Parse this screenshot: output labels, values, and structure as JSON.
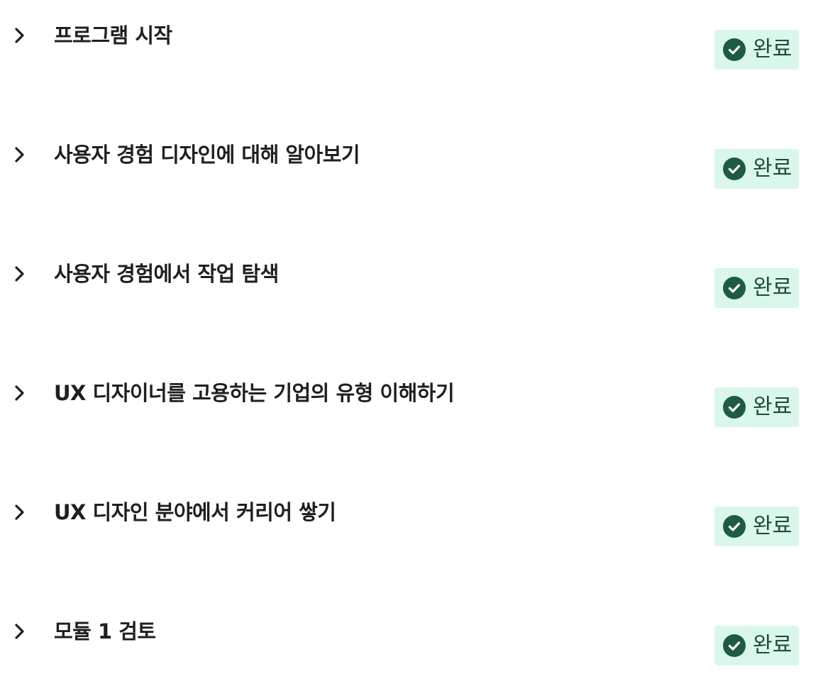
{
  "modules": [
    {
      "title": "프로그램 시작",
      "status": "완료",
      "status_icon": "check-circle-icon",
      "expand_icon": "chevron-right-icon"
    },
    {
      "title": "사용자 경험 디자인에 대해 알아보기",
      "status": "완료",
      "status_icon": "check-circle-icon",
      "expand_icon": "chevron-right-icon"
    },
    {
      "title": "사용자 경험에서 작업 탐색",
      "status": "완료",
      "status_icon": "check-circle-icon",
      "expand_icon": "chevron-right-icon"
    },
    {
      "title": "UX 디자이너를 고용하는 기업의 유형 이해하기",
      "status": "완료",
      "status_icon": "check-circle-icon",
      "expand_icon": "chevron-right-icon"
    },
    {
      "title": "UX 디자인 분야에서 커리어 쌓기",
      "status": "완료",
      "status_icon": "check-circle-icon",
      "expand_icon": "chevron-right-icon"
    },
    {
      "title": "모듈 1 검토",
      "status": "완료",
      "status_icon": "check-circle-icon",
      "expand_icon": "chevron-right-icon"
    }
  ],
  "colors": {
    "badge_background": "#d9f7ea",
    "badge_text": "#1e4d3a",
    "check_icon": "#1e5b43",
    "title_text": "#1f1f1f"
  }
}
